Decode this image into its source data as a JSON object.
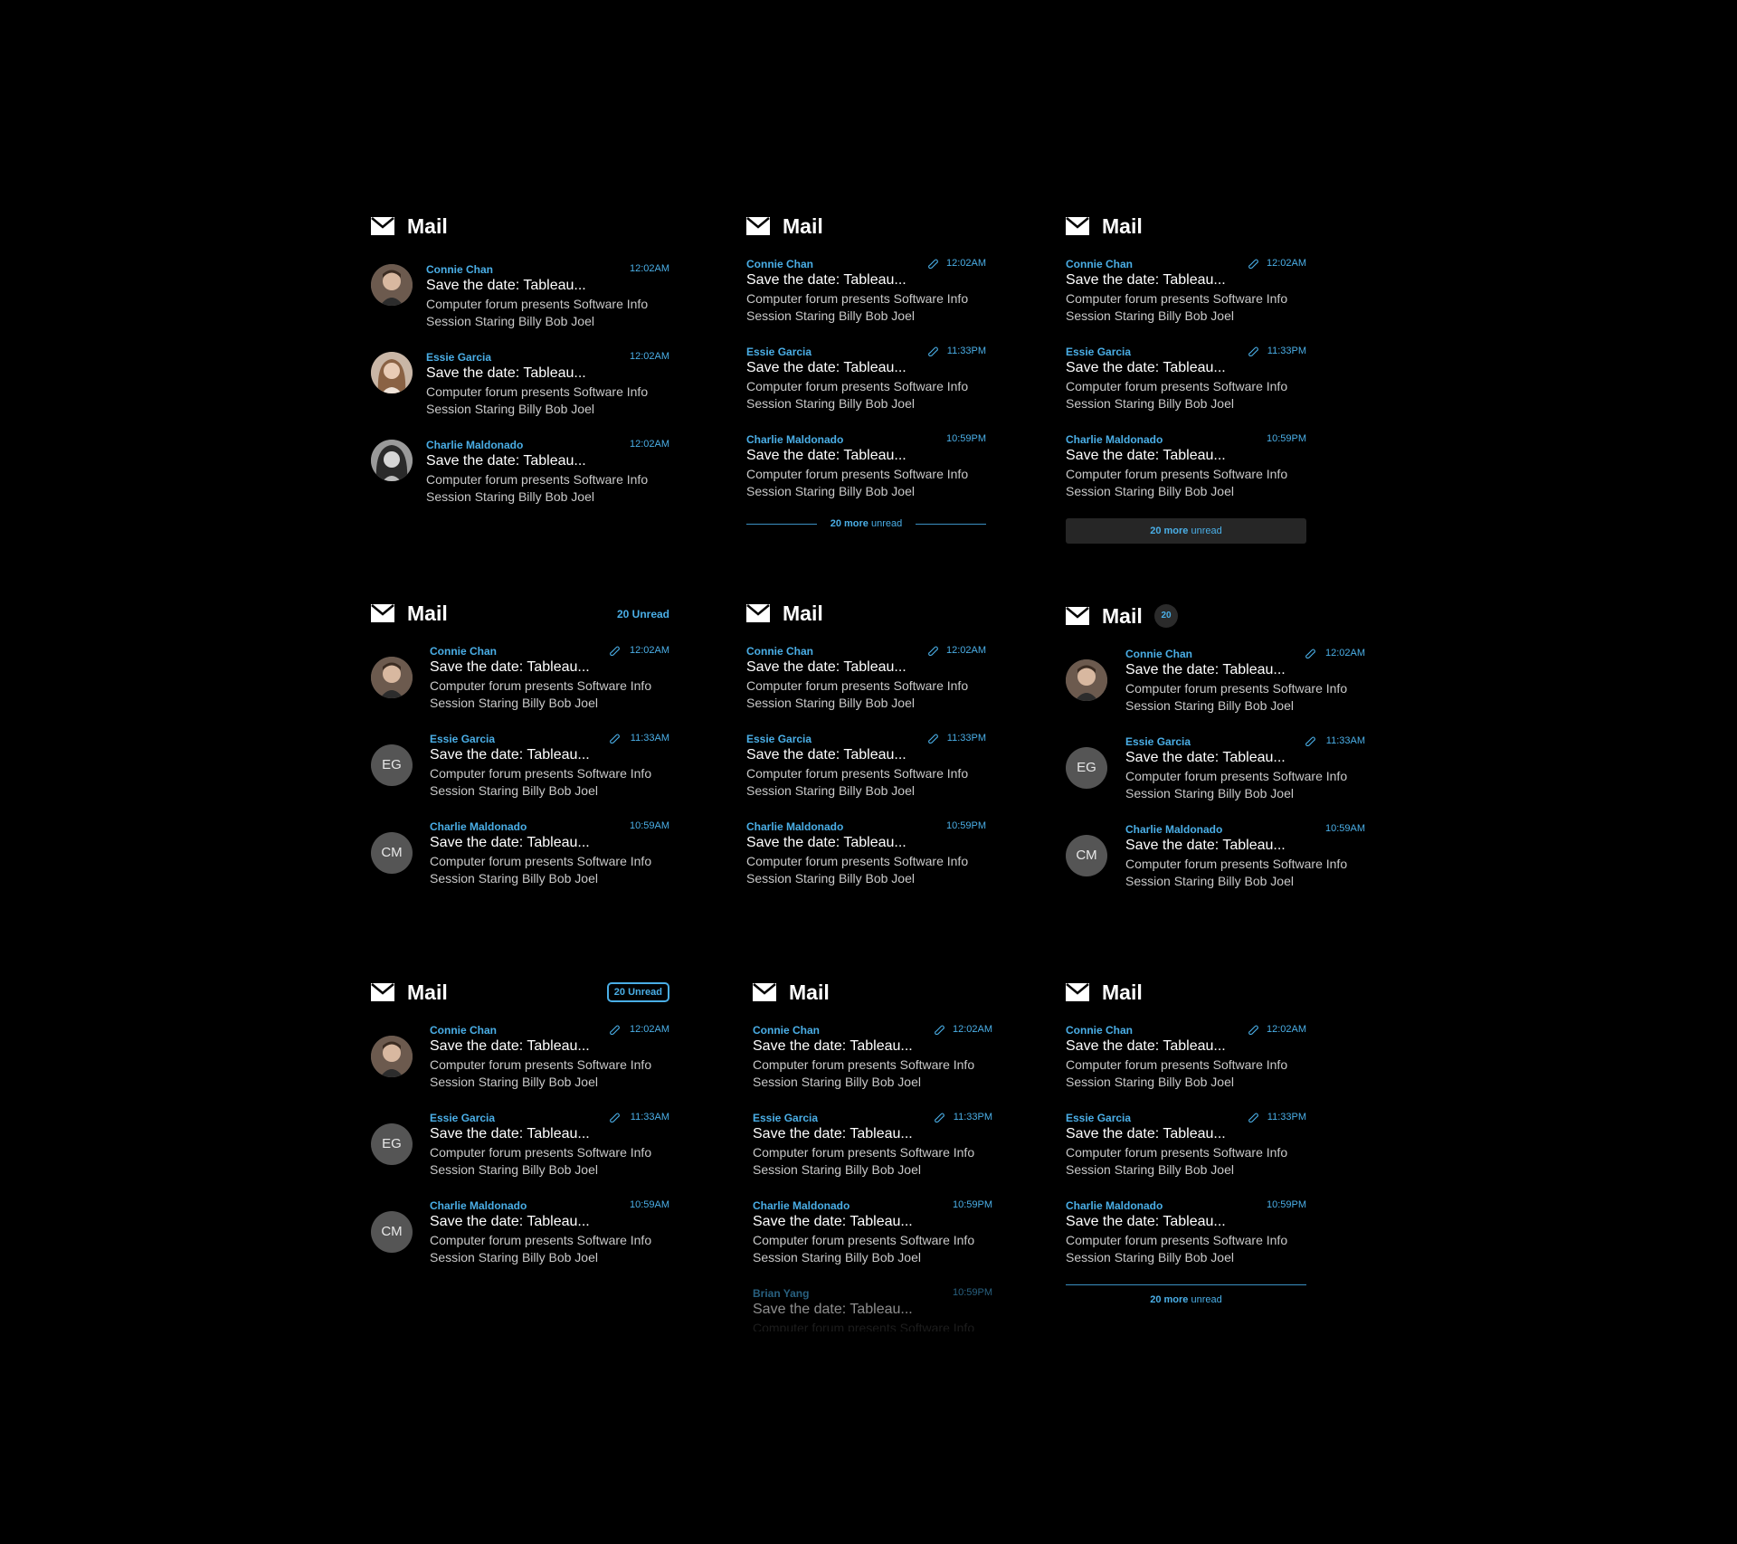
{
  "mail_title": "Mail",
  "messages": [
    {
      "sender": "Connie Chan",
      "time": "12:02AM",
      "subject": "Save the date: Tableau...",
      "preview": "Computer forum presents Software Info Session Staring Billy Bob Joel"
    },
    {
      "sender": "Essie Garcia",
      "time": "12:02AM",
      "subject": "Save the date: Tableau...",
      "preview": "Computer forum presents Software Info Session Staring Billy Bob Joel"
    },
    {
      "sender": "Charlie Maldonado",
      "time": "12:02AM",
      "subject": "Save the date: Tableau...",
      "preview": "Computer forum presents Software Info Session Staring Billy Bob Joel"
    },
    {
      "sender": "Brian Yang",
      "time": "10:59PM",
      "subject": "Save the date: Tableau...",
      "preview": "Computer forum presents Software Info"
    }
  ],
  "times": {
    "t1202": "12:02AM",
    "t1133pm": "11:33PM",
    "t1059pm": "10:59PM",
    "t1133am": "11:33AM",
    "t1059am": "10:59AM"
  },
  "initials": {
    "essie": "EG",
    "charlie": "CM"
  },
  "unread": {
    "header_label": "20 Unread",
    "badge_count": "20",
    "more_count": "20 more",
    "more_suffix": " unread"
  },
  "colors": {
    "background": "#000000",
    "accent": "#4aaee6",
    "avatar_bg": "#555555"
  },
  "icons": [
    "mail-icon",
    "attachment-icon"
  ]
}
